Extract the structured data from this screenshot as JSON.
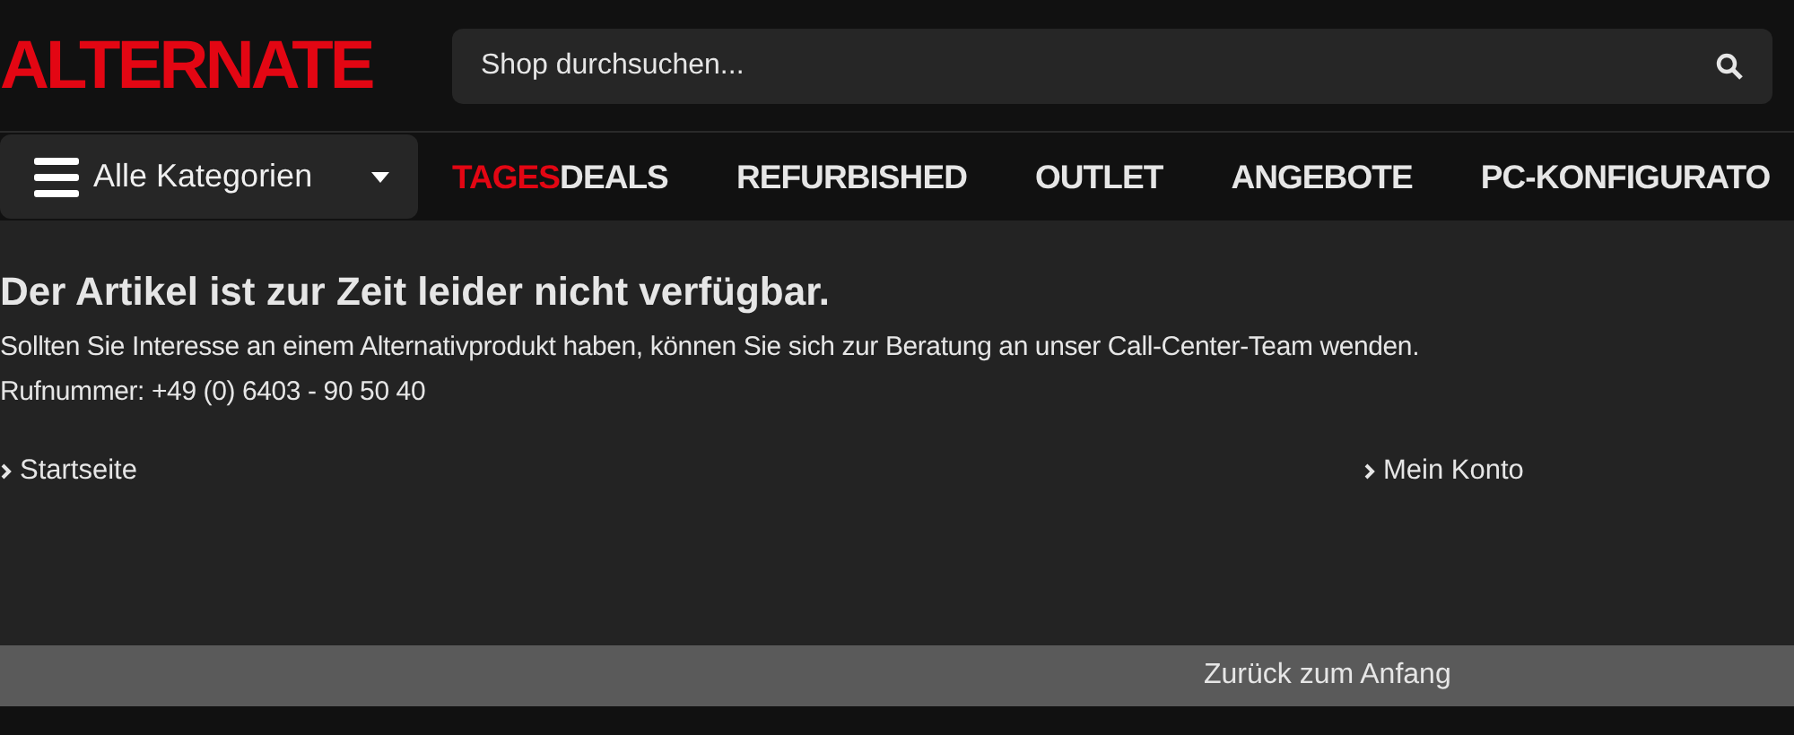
{
  "logo": "ALTERNATE",
  "search": {
    "placeholder": "Shop durchsuchen..."
  },
  "category_button": {
    "label": "Alle Kategorien"
  },
  "nav": [
    {
      "parts": [
        {
          "text": "TAGES",
          "accent": true
        },
        {
          "text": "DEALS",
          "accent": false
        }
      ]
    },
    {
      "parts": [
        {
          "text": "REFURBISHED",
          "accent": false
        }
      ]
    },
    {
      "parts": [
        {
          "text": "OUTLET",
          "accent": false
        }
      ]
    },
    {
      "parts": [
        {
          "text": "ANGEBOTE",
          "accent": false
        }
      ]
    },
    {
      "parts": [
        {
          "text": "PC-KONFIGURATO",
          "accent": false
        }
      ]
    }
  ],
  "message": {
    "title": "Der Artikel ist zur Zeit leider nicht verfügbar.",
    "lines": [
      "Sollten Sie Interesse an einem Alternativprodukt haben, können Sie sich zur Beratung an unser Call-Center-Team wenden.",
      "Rufnummer: +49 (0) 6403 - 90 50 40"
    ]
  },
  "links": [
    "Startseite",
    "Mein Konto"
  ],
  "back_to_top": "Zurück zum Anfang"
}
